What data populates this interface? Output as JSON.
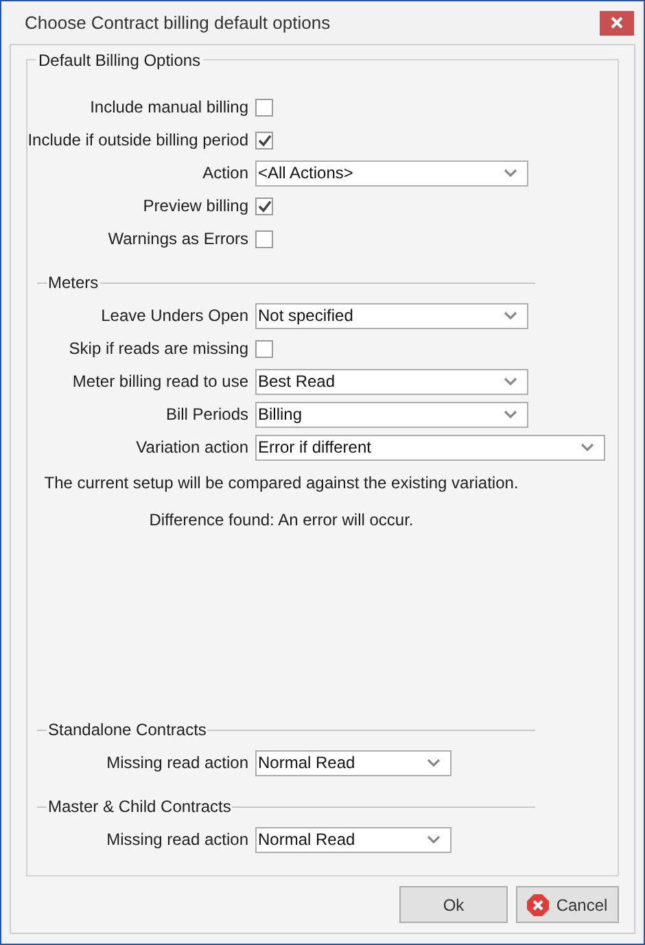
{
  "window": {
    "title": "Choose Contract billing default options"
  },
  "group": {
    "title": "Default Billing Options"
  },
  "sections": [
    {
      "rows": [
        {
          "kind": "checkbox",
          "label": "Include manual billing",
          "checked": false
        },
        {
          "kind": "checkbox",
          "label": "Include if outside billing period",
          "checked": true
        },
        {
          "kind": "dropdown",
          "label": "Action",
          "value": "<All Actions>"
        },
        {
          "kind": "checkbox",
          "label": "Preview billing",
          "checked": true
        },
        {
          "kind": "checkbox",
          "label": "Warnings as Errors",
          "checked": false
        }
      ]
    },
    {
      "title": "Meters",
      "rows": [
        {
          "kind": "dropdown",
          "label": "Leave Unders Open",
          "value": "Not specified"
        },
        {
          "kind": "checkbox",
          "label": "Skip if reads are missing",
          "checked": false
        },
        {
          "kind": "dropdown",
          "label": "Meter billing read to use",
          "value": "Best Read"
        },
        {
          "kind": "dropdown",
          "label": "Bill Periods",
          "value": "Billing"
        },
        {
          "kind": "dropdown",
          "label": "Variation action",
          "value": "Error if different"
        },
        {
          "kind": "note",
          "text": "The current setup will be compared against the existing variation."
        },
        {
          "kind": "note",
          "text": "Difference found: An error will occur."
        }
      ]
    },
    {
      "title": "Standalone Contracts",
      "rows": [
        {
          "kind": "dropdown",
          "label": "Missing read action",
          "value": "Normal Read"
        }
      ]
    },
    {
      "title": "Master & Child Contracts",
      "rows": [
        {
          "kind": "dropdown",
          "label": "Missing read action",
          "value": "Normal Read"
        }
      ]
    }
  ],
  "buttons": [
    {
      "label": "Ok",
      "kind": "ok"
    },
    {
      "label": "Cancel",
      "kind": "cancel"
    }
  ]
}
